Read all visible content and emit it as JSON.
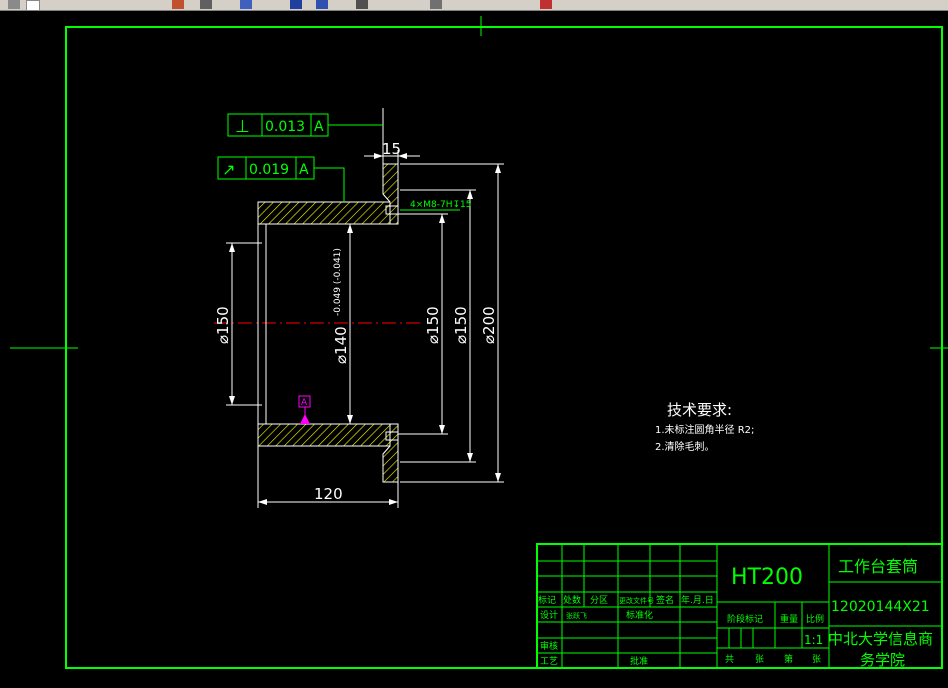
{
  "colors": {
    "frame": "#00ff00",
    "text": "#ffffff",
    "dim_text": "#00ff00",
    "hatch": "#ffff00",
    "center": "#ff0000",
    "datum": "#ff00ff",
    "background": "#000000"
  },
  "toolbar": {
    "icons": [
      "grid-icon",
      "pencil-icon",
      "pan-icon",
      "zoom-icon",
      "undo-icon",
      "refresh-icon",
      "arrow-icon",
      "close-icon"
    ]
  },
  "drawing": {
    "gdt1": {
      "symbol": "⊥",
      "value": "0.013",
      "datum": "A"
    },
    "gdt2": {
      "symbol": "↗",
      "value": "0.019",
      "datum": "A"
    },
    "dims": {
      "top": "15",
      "thread": "4×M8-7H↧15",
      "d150_left": "⌀150",
      "d140": "⌀140",
      "d140_tol": "-0.049 (-0.041)",
      "d150_a": "⌀150",
      "d150_b": "⌀150",
      "d200": "⌀200",
      "bottom": "120"
    },
    "datum_tag": "A"
  },
  "notes": {
    "title": "技术要求:",
    "items": [
      "1.未标注圆角半径 R2;",
      "2.清除毛刺。"
    ]
  },
  "title_block": {
    "material": "HT200",
    "part_name": "工作台套筒",
    "drawing_no": "12020144X21",
    "org_line1": "中北大学信息商",
    "org_line2": "务学院",
    "scale": "1:1",
    "row_labels": [
      "标记",
      "处数",
      "分区",
      "更改文件号",
      "签名",
      "年.月.日"
    ],
    "design": "设计",
    "designer": "张跃飞",
    "standard": "标准化",
    "stage": "阶段标记",
    "weight": "重量",
    "ratio": "比例",
    "review": "审核",
    "process": "工艺",
    "approve": "批准",
    "sheet_total": "共",
    "sheet_unit": "张",
    "sheet_no": "第",
    "sheet_unit2": "张"
  }
}
